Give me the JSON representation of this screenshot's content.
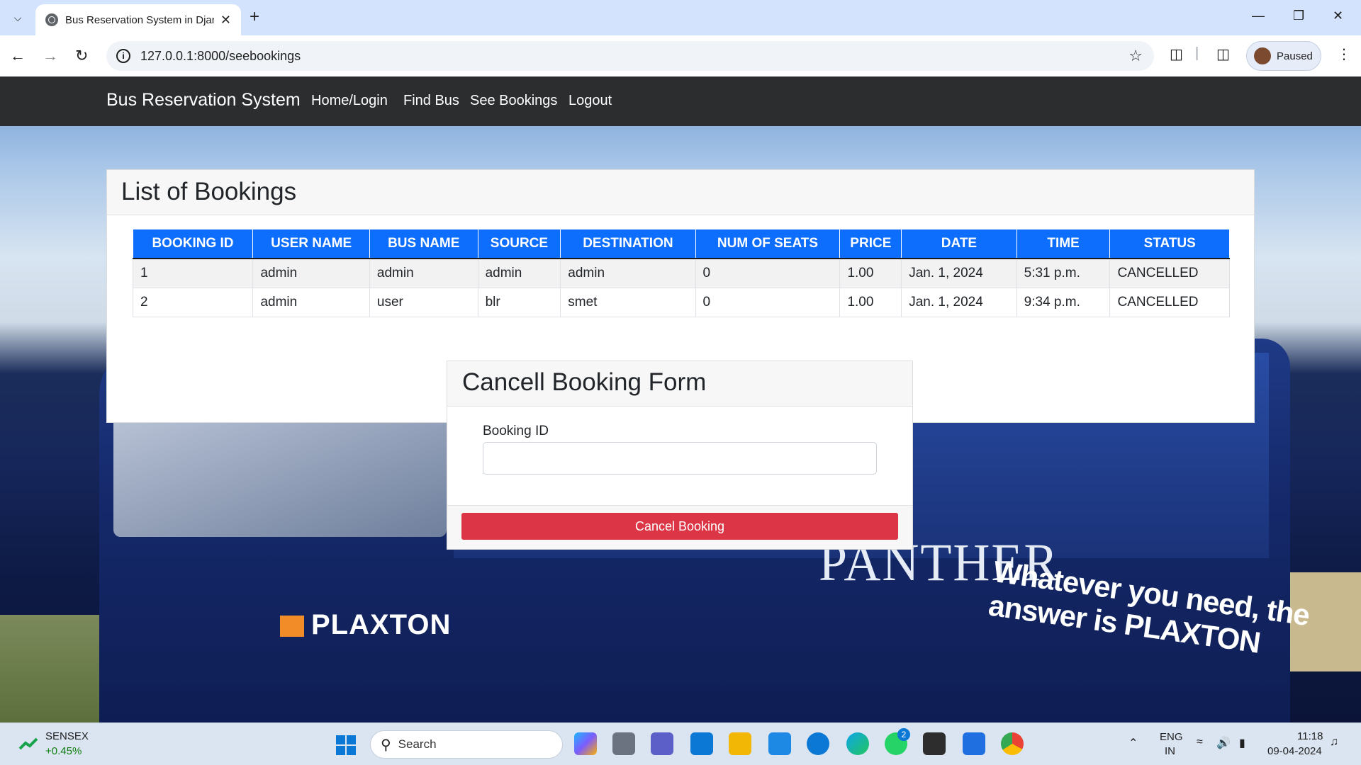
{
  "browser": {
    "tab_title": "Bus Reservation System in Djan",
    "url": "127.0.0.1:8000/seebookings",
    "profile_status": "Paused",
    "icons": {
      "tab_search": "chevron-down-icon",
      "favicon": "globe-icon",
      "close_tab": "close-icon",
      "new_tab": "plus-icon",
      "back": "arrow-left-icon",
      "forward": "arrow-right-icon",
      "reload": "reload-icon",
      "site_info": "info-icon",
      "bookmark": "star-icon",
      "extensions": "puzzle-icon",
      "side_panel": "side-panel-icon",
      "menu": "kebab-menu-icon"
    }
  },
  "navbar": {
    "brand": "Bus Reservation System",
    "links": [
      "Home/Login",
      "Find Bus",
      "See Bookings",
      "Logout"
    ]
  },
  "bookings": {
    "title": "List of Bookings",
    "columns": [
      "BOOKING ID",
      "USER NAME",
      "BUS NAME",
      "SOURCE",
      "DESTINATION",
      "NUM OF SEATS",
      "PRICE",
      "DATE",
      "TIME",
      "STATUS"
    ],
    "rows": [
      [
        "1",
        "admin",
        "admin",
        "admin",
        "admin",
        "0",
        "1.00",
        "Jan. 1, 2024",
        "5:31 p.m.",
        "CANCELLED"
      ],
      [
        "2",
        "admin",
        "user",
        "blr",
        "smet",
        "0",
        "1.00",
        "Jan. 1, 2024",
        "9:34 p.m.",
        "CANCELLED"
      ]
    ],
    "header_color": "#0d6efd"
  },
  "cancel_form": {
    "title": "Cancell Booking Form",
    "field_label": "Booking ID",
    "field_value": "",
    "button_label": "Cancel Booking",
    "button_color": "#dc3545"
  },
  "background": {
    "brand_text": "PLAXTON",
    "model_text": "PANTHER",
    "slogan": "Whatever you need, the answer is PLAXTON"
  },
  "taskbar": {
    "ticker_name": "SENSEX",
    "ticker_change": "+0.45%",
    "search_placeholder": "Search",
    "notification_badge": "2",
    "language_line1": "ENG",
    "language_line2": "IN",
    "time": "11:18",
    "date": "09-04-2024"
  }
}
